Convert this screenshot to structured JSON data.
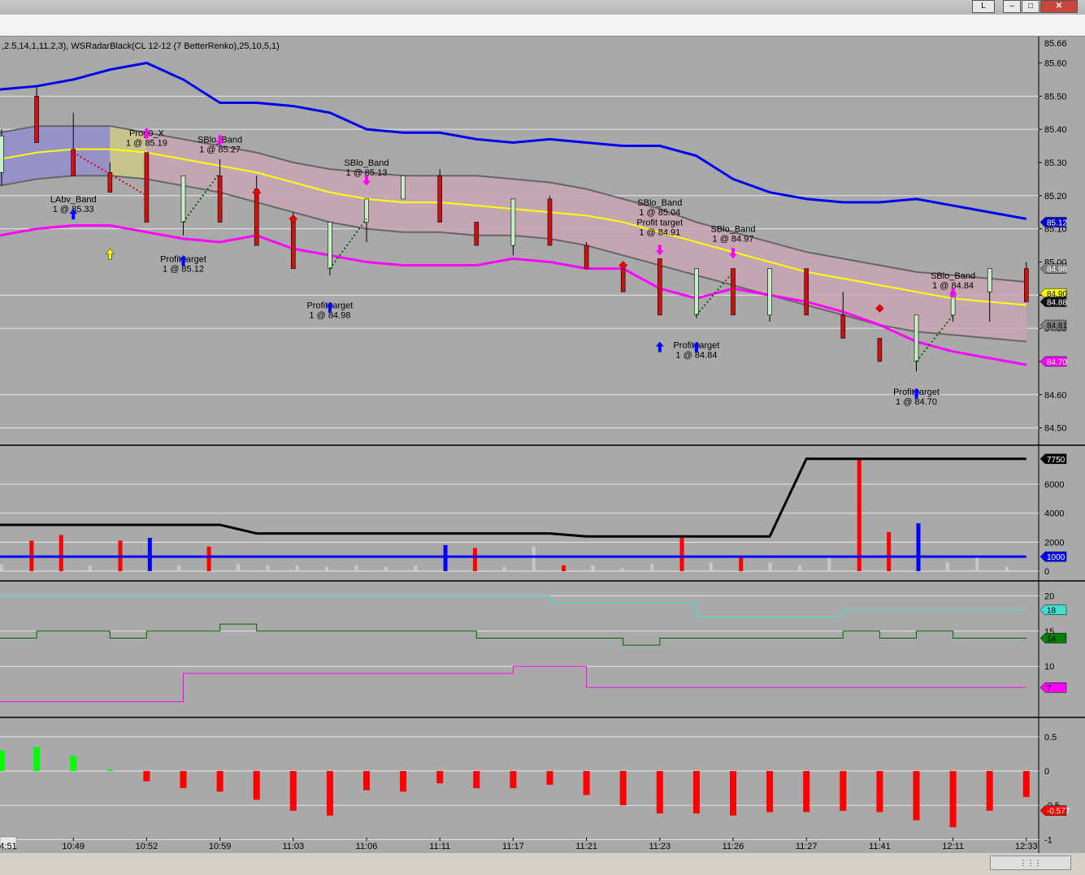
{
  "window": {
    "title_button": "L",
    "controls": [
      "–",
      "□",
      "✕"
    ]
  },
  "chart_data": [
    {
      "type": "candlestick",
      "title": ",2.5,14,1,11,2,3), WSRadarBlack(CL 12-12 (7 BetterRenko),25,10,5,1)",
      "ylim": [
        84.45,
        85.66
      ],
      "y_ticks": [
        "85.60",
        "85.50",
        "85.40",
        "85.30",
        "85.20",
        "85.10",
        "85.00",
        "84.90",
        "84.80",
        "84.70",
        "84.60",
        "84.50"
      ],
      "top_price": "85.66",
      "x_ticks": [
        "4:51",
        "10:49",
        "10:52",
        "10:59",
        "11:03",
        "11:06",
        "11:11",
        "11:17",
        "11:21",
        "11:23",
        "11:26",
        "11:27",
        "11:41",
        "12:11",
        "12:33"
      ],
      "candles": [
        {
          "o": 85.27,
          "c": 85.38,
          "h": 85.4,
          "l": 85.23,
          "bull": true
        },
        {
          "o": 85.5,
          "c": 85.36,
          "h": 85.53,
          "l": 85.36,
          "bull": false
        },
        {
          "o": 85.34,
          "c": 85.26,
          "h": 85.45,
          "l": 85.26,
          "bull": false
        },
        {
          "o": 85.27,
          "c": 85.21,
          "h": 85.3,
          "l": 85.21,
          "bull": false
        },
        {
          "o": 85.33,
          "c": 85.12,
          "h": 85.33,
          "l": 85.12,
          "bull": false
        },
        {
          "o": 85.12,
          "c": 85.26,
          "h": 85.26,
          "l": 85.08,
          "bull": true
        },
        {
          "o": 85.26,
          "c": 85.12,
          "h": 85.31,
          "l": 85.12,
          "bull": false
        },
        {
          "o": 85.22,
          "c": 85.05,
          "h": 85.26,
          "l": 85.05,
          "bull": false
        },
        {
          "o": 85.13,
          "c": 84.98,
          "h": 85.15,
          "l": 84.98,
          "bull": false
        },
        {
          "o": 84.98,
          "c": 85.12,
          "h": 85.12,
          "l": 84.96,
          "bull": true
        },
        {
          "o": 85.12,
          "c": 85.19,
          "h": 85.19,
          "l": 85.06,
          "bull": true
        },
        {
          "o": 85.19,
          "c": 85.26,
          "h": 85.26,
          "l": 85.19,
          "bull": true
        },
        {
          "o": 85.26,
          "c": 85.12,
          "h": 85.28,
          "l": 85.12,
          "bull": false
        },
        {
          "o": 85.12,
          "c": 85.05,
          "h": 85.12,
          "l": 85.05,
          "bull": false
        },
        {
          "o": 85.05,
          "c": 85.19,
          "h": 85.19,
          "l": 85.02,
          "bull": true
        },
        {
          "o": 85.19,
          "c": 85.05,
          "h": 85.2,
          "l": 85.05,
          "bull": false
        },
        {
          "o": 85.05,
          "c": 84.98,
          "h": 85.06,
          "l": 84.98,
          "bull": false
        },
        {
          "o": 84.98,
          "c": 84.91,
          "h": 84.98,
          "l": 84.91,
          "bull": false
        },
        {
          "o": 85.01,
          "c": 84.84,
          "h": 85.01,
          "l": 84.84,
          "bull": false
        },
        {
          "o": 84.84,
          "c": 84.98,
          "h": 84.98,
          "l": 84.83,
          "bull": true
        },
        {
          "o": 84.98,
          "c": 84.84,
          "h": 84.98,
          "l": 84.84,
          "bull": false
        },
        {
          "o": 84.84,
          "c": 84.98,
          "h": 84.98,
          "l": 84.82,
          "bull": true
        },
        {
          "o": 84.98,
          "c": 84.84,
          "h": 84.98,
          "l": 84.84,
          "bull": false
        },
        {
          "o": 84.84,
          "c": 84.77,
          "h": 84.91,
          "l": 84.77,
          "bull": false
        },
        {
          "o": 84.77,
          "c": 84.7,
          "h": 84.77,
          "l": 84.7,
          "bull": false
        },
        {
          "o": 84.7,
          "c": 84.84,
          "h": 84.84,
          "l": 84.67,
          "bull": true
        },
        {
          "o": 84.84,
          "c": 84.91,
          "h": 84.91,
          "l": 84.82,
          "bull": true
        },
        {
          "o": 84.91,
          "c": 84.98,
          "h": 84.98,
          "l": 84.82,
          "bull": true
        },
        {
          "o": 84.98,
          "c": 84.88,
          "h": 85.0,
          "l": 84.88,
          "bull": false
        }
      ],
      "series": [
        {
          "name": "upper",
          "color": "#0000ee",
          "values": [
            85.52,
            85.53,
            85.55,
            85.58,
            85.6,
            85.55,
            85.48,
            85.48,
            85.47,
            85.45,
            85.4,
            85.39,
            85.39,
            85.37,
            85.36,
            85.37,
            85.36,
            85.35,
            85.35,
            85.32,
            85.25,
            85.21,
            85.19,
            85.18,
            85.18,
            85.19,
            85.17,
            85.15,
            85.13
          ]
        },
        {
          "name": "band_top",
          "color": "#666666",
          "values": [
            85.39,
            85.41,
            85.41,
            85.41,
            85.39,
            85.37,
            85.35,
            85.33,
            85.3,
            85.28,
            85.27,
            85.26,
            85.26,
            85.26,
            85.25,
            85.24,
            85.22,
            85.19,
            85.16,
            85.12,
            85.09,
            85.06,
            85.03,
            85.01,
            84.99,
            84.97,
            84.96,
            84.95,
            84.94
          ]
        },
        {
          "name": "middle",
          "color": "#ffff00",
          "values": [
            85.31,
            85.33,
            85.34,
            85.34,
            85.33,
            85.31,
            85.29,
            85.27,
            85.24,
            85.21,
            85.19,
            85.18,
            85.18,
            85.17,
            85.16,
            85.15,
            85.14,
            85.12,
            85.09,
            85.06,
            85.03,
            85.0,
            84.97,
            84.95,
            84.93,
            84.91,
            84.89,
            84.88,
            84.87
          ]
        },
        {
          "name": "band_bottom",
          "color": "#666666",
          "values": [
            85.23,
            85.25,
            85.26,
            85.26,
            85.25,
            85.23,
            85.21,
            85.18,
            85.15,
            85.12,
            85.1,
            85.09,
            85.09,
            85.08,
            85.08,
            85.07,
            85.05,
            85.02,
            84.99,
            84.96,
            84.93,
            84.9,
            84.87,
            84.84,
            84.81,
            84.79,
            84.78,
            84.77,
            84.76
          ]
        },
        {
          "name": "lower",
          "color": "#ff00ff",
          "values": [
            85.08,
            85.1,
            85.11,
            85.11,
            85.09,
            85.07,
            85.06,
            85.08,
            85.04,
            85.02,
            85.0,
            84.99,
            84.99,
            84.99,
            85.01,
            85.0,
            84.98,
            84.98,
            84.92,
            84.89,
            84.92,
            84.9,
            84.88,
            84.85,
            84.81,
            84.76,
            84.73,
            84.71,
            84.69
          ]
        }
      ],
      "right_labels": [
        {
          "text": "85.12",
          "value": 85.12,
          "bg": "#0000cc",
          "fg": "#ffffff"
        },
        {
          "text": "84.98",
          "value": 84.98,
          "bg": "#808080",
          "fg": "#ffffff"
        },
        {
          "text": "84.90",
          "value": 84.905,
          "bg": "#ffff00",
          "fg": "#000000"
        },
        {
          "text": "84.88",
          "value": 84.88,
          "bg": "#111111",
          "fg": "#ffffff"
        },
        {
          "text": "84.81",
          "value": 84.81,
          "bg": "#808080",
          "fg": "#000000"
        },
        {
          "text": "84.70",
          "value": 84.7,
          "bg": "#ff00ff",
          "fg": "#ffffff"
        }
      ],
      "annotations": [
        {
          "text": "Prog0_X",
          "sub": "1 @ 85.19",
          "bar": 4,
          "price": 85.38
        },
        {
          "text": "SBlo_Band",
          "sub": "1 @ 85.27",
          "bar": 6,
          "price": 85.36
        },
        {
          "text": "LAbv_Band",
          "sub": "1 @ 85.33",
          "bar": 2,
          "price": 85.18
        },
        {
          "text": "Profit target",
          "sub": "1 @ 85.12",
          "bar": 5,
          "price": 85.0
        },
        {
          "text": "SBlo_Band",
          "sub": "1 @ 85.13",
          "bar": 10,
          "price": 85.29
        },
        {
          "text": "Profit target",
          "sub": "1 @ 84.98",
          "bar": 9,
          "price": 84.86
        },
        {
          "text": "SBlo_Band",
          "sub": "1 @ 85.04",
          "bar": 18,
          "price": 85.17
        },
        {
          "text": "Profit target",
          "sub": "1 @ 84.91",
          "bar": 18,
          "price": 85.11
        },
        {
          "text": "SBlo_Band",
          "sub": "1 @ 84.97",
          "bar": 20,
          "price": 85.09
        },
        {
          "text": "Profit target",
          "sub": "1 @ 84.84",
          "bar": 19,
          "price": 84.74
        },
        {
          "text": "SBlo_Band",
          "sub": "1 @ 84.84",
          "bar": 26,
          "price": 84.95
        },
        {
          "text": "Profit target",
          "sub": "1 @ 84.70",
          "bar": 25,
          "price": 84.6
        }
      ]
    },
    {
      "type": "bar",
      "name": "volume",
      "ylim": [
        0,
        8300
      ],
      "y_ticks": [
        "6000",
        "4000",
        "2000",
        "0"
      ],
      "values": [
        450,
        2100,
        2500,
        400,
        2100,
        2300,
        400,
        1700,
        500,
        400,
        400,
        300,
        400,
        300,
        400,
        1800,
        1600,
        300,
        1700,
        400,
        400,
        200,
        500,
        2300,
        600,
        1000,
        600,
        400,
        1000,
        7700,
        2700,
        3300,
        600,
        1100,
        300
      ],
      "colors": [
        "gray",
        "red",
        "red",
        "gray",
        "red",
        "blue",
        "gray",
        "red",
        "gray",
        "gray",
        "gray",
        "gray",
        "gray",
        "gray",
        "gray",
        "blue",
        "red",
        "gray",
        "gray",
        "red",
        "gray",
        "gray",
        "gray",
        "red",
        "gray",
        "red",
        "gray",
        "gray",
        "gray",
        "red",
        "red",
        "blue",
        "gray",
        "gray",
        "gray"
      ],
      "series": [
        {
          "name": "cumulative",
          "color": "#000000",
          "values": [
            3200,
            3200,
            3200,
            3200,
            3200,
            3200,
            3200,
            2600,
            2600,
            2600,
            2600,
            2600,
            2600,
            2600,
            2600,
            2600,
            2400,
            2400,
            2400,
            2400,
            2400,
            2400,
            7750,
            7750,
            7750,
            7750,
            7750,
            7750,
            7750
          ]
        },
        {
          "name": "baseline",
          "color": "#0000ff",
          "values": [
            1000,
            1000,
            1000,
            1000,
            1000,
            1000,
            1000,
            1000,
            1000,
            1000,
            1000,
            1000,
            1000,
            1000,
            1000,
            1000,
            1000,
            1000,
            1000,
            1000,
            1000,
            1000,
            1000,
            1000,
            1000,
            1000,
            1000,
            1000,
            1000
          ]
        }
      ],
      "right_labels": [
        {
          "text": "7750",
          "value": 7750,
          "bg": "#000000",
          "fg": "#ffffff"
        },
        {
          "text": "1000",
          "value": 1000,
          "bg": "#0000ff",
          "fg": "#ffffff"
        }
      ]
    },
    {
      "type": "line",
      "name": "oscillator",
      "ylim": [
        3,
        22
      ],
      "y_ticks": [
        "20",
        "15",
        "10"
      ],
      "series": [
        {
          "name": "cyan",
          "color": "#40e0d0",
          "values": [
            20,
            20,
            20,
            20,
            20,
            20,
            20,
            20,
            20,
            20,
            20,
            20,
            20,
            20,
            20,
            19,
            19,
            19,
            19,
            17,
            17,
            17,
            17,
            18,
            18,
            18,
            18,
            18,
            18
          ]
        },
        {
          "name": "green",
          "color": "#006400",
          "values": [
            14,
            15,
            15,
            14,
            15,
            15,
            16,
            15,
            15,
            15,
            15,
            15,
            15,
            14,
            14,
            14,
            14,
            13,
            14,
            14,
            14,
            14,
            14,
            15,
            14,
            15,
            14,
            14,
            14
          ]
        },
        {
          "name": "magenta",
          "color": "#ff00ff",
          "values": [
            5,
            5,
            5,
            5,
            5,
            9,
            9,
            9,
            9,
            9,
            9,
            9,
            9,
            9,
            10,
            10,
            7,
            7,
            7,
            7,
            7,
            7,
            7,
            7,
            7,
            7,
            7,
            7,
            7
          ]
        }
      ],
      "right_labels": [
        {
          "text": "18",
          "value": 18,
          "bg": "#40e0d0",
          "fg": "#000000"
        },
        {
          "text": "14",
          "value": 14,
          "bg": "#008000",
          "fg": "#000000"
        },
        {
          "text": "7",
          "value": 7,
          "bg": "#ff00ff",
          "fg": "#000000"
        }
      ]
    },
    {
      "type": "bar",
      "name": "histogram",
      "ylim": [
        -1.15,
        0.7
      ],
      "y_ticks": [
        "0.5",
        "0",
        "-0.5",
        "-1"
      ],
      "values": [
        0.3,
        0.35,
        0.22,
        0.02,
        -0.15,
        -0.25,
        -0.3,
        -0.42,
        -0.58,
        -0.65,
        -0.28,
        -0.3,
        -0.18,
        -0.25,
        -0.25,
        -0.2,
        -0.35,
        -0.5,
        -0.62,
        -0.62,
        -0.65,
        -0.6,
        -0.6,
        -0.58,
        -0.6,
        -0.72,
        -0.82,
        -0.58,
        -0.38
      ],
      "right_labels": [
        {
          "text": "-0.577",
          "value": -0.577,
          "bg": "#ff0000",
          "fg": "#ffffff"
        }
      ]
    }
  ]
}
